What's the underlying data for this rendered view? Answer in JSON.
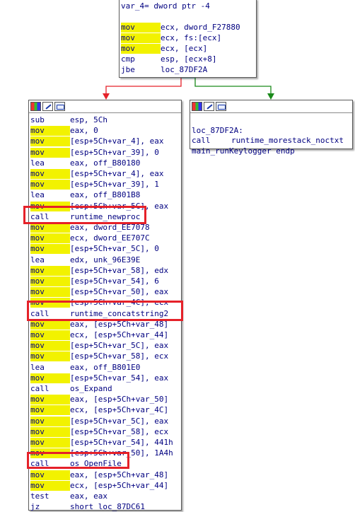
{
  "top_block": {
    "lines": [
      {
        "mnemonic": "var_4= dword ptr -4",
        "operands": "",
        "highlight": false
      },
      {
        "mnemonic": "",
        "operands": "",
        "highlight": false
      },
      {
        "mnemonic": "mov",
        "operands": "ecx, dword_F27880",
        "highlight": true
      },
      {
        "mnemonic": "mov",
        "operands": "ecx, fs:[ecx]",
        "highlight": true
      },
      {
        "mnemonic": "mov",
        "operands": "ecx, [ecx]",
        "highlight": true
      },
      {
        "mnemonic": "cmp",
        "operands": "esp, [ecx+8]",
        "highlight": false
      },
      {
        "mnemonic": "jbe",
        "operands": "loc_87DF2A",
        "highlight": false
      }
    ]
  },
  "left_block": {
    "lines": [
      {
        "mnemonic": "sub",
        "operands": "esp, 5Ch",
        "highlight": false
      },
      {
        "mnemonic": "mov",
        "operands": "eax, 0",
        "highlight": true
      },
      {
        "mnemonic": "mov",
        "operands": "[esp+5Ch+var_4], eax",
        "highlight": true
      },
      {
        "mnemonic": "mov",
        "operands": "[esp+5Ch+var_39], 0",
        "highlight": true
      },
      {
        "mnemonic": "lea",
        "operands": "eax, off_B80180",
        "highlight": false
      },
      {
        "mnemonic": "mov",
        "operands": "[esp+5Ch+var_4], eax",
        "highlight": true
      },
      {
        "mnemonic": "mov",
        "operands": "[esp+5Ch+var_39], 1",
        "highlight": true
      },
      {
        "mnemonic": "lea",
        "operands": "eax, off_B801B8",
        "highlight": false
      },
      {
        "mnemonic": "mov",
        "operands": "[esp+5Ch+var_5C], eax",
        "highlight": true
      },
      {
        "mnemonic": "call",
        "operands": "runtime_newproc",
        "highlight": false
      },
      {
        "mnemonic": "mov",
        "operands": "eax, dword_EE7078",
        "highlight": true
      },
      {
        "mnemonic": "mov",
        "operands": "ecx, dword_EE707C",
        "highlight": true
      },
      {
        "mnemonic": "mov",
        "operands": "[esp+5Ch+var_5C], 0",
        "highlight": true
      },
      {
        "mnemonic": "lea",
        "operands": "edx, unk_96E39E",
        "highlight": false
      },
      {
        "mnemonic": "mov",
        "operands": "[esp+5Ch+var_58], edx",
        "highlight": true
      },
      {
        "mnemonic": "mov",
        "operands": "[esp+5Ch+var_54], 6",
        "highlight": true
      },
      {
        "mnemonic": "mov",
        "operands": "[esp+5Ch+var_50], eax",
        "highlight": true
      },
      {
        "mnemonic": "mov",
        "operands": "[esp+5Ch+var_4C], ecx",
        "highlight": true
      },
      {
        "mnemonic": "call",
        "operands": "runtime_concatstring2",
        "highlight": false
      },
      {
        "mnemonic": "mov",
        "operands": "eax, [esp+5Ch+var_48]",
        "highlight": true
      },
      {
        "mnemonic": "mov",
        "operands": "ecx, [esp+5Ch+var_44]",
        "highlight": true
      },
      {
        "mnemonic": "mov",
        "operands": "[esp+5Ch+var_5C], eax",
        "highlight": true
      },
      {
        "mnemonic": "mov",
        "operands": "[esp+5Ch+var_58], ecx",
        "highlight": true
      },
      {
        "mnemonic": "lea",
        "operands": "eax, off_B801E0",
        "highlight": false
      },
      {
        "mnemonic": "mov",
        "operands": "[esp+5Ch+var_54], eax",
        "highlight": true
      },
      {
        "mnemonic": "call",
        "operands": "os_Expand",
        "highlight": false
      },
      {
        "mnemonic": "mov",
        "operands": "eax, [esp+5Ch+var_50]",
        "highlight": true
      },
      {
        "mnemonic": "mov",
        "operands": "ecx, [esp+5Ch+var_4C]",
        "highlight": true
      },
      {
        "mnemonic": "mov",
        "operands": "[esp+5Ch+var_5C], eax",
        "highlight": true
      },
      {
        "mnemonic": "mov",
        "operands": "[esp+5Ch+var_58], ecx",
        "highlight": true
      },
      {
        "mnemonic": "mov",
        "operands": "[esp+5Ch+var_54], 441h",
        "highlight": true
      },
      {
        "mnemonic": "mov",
        "operands": "[esp+5Ch+var_50], 1A4h",
        "highlight": true
      },
      {
        "mnemonic": "call",
        "operands": "os_OpenFile",
        "highlight": false
      },
      {
        "mnemonic": "mov",
        "operands": "eax, [esp+5Ch+var_48]",
        "highlight": true
      },
      {
        "mnemonic": "mov",
        "operands": "ecx, [esp+5Ch+var_44]",
        "highlight": true
      },
      {
        "mnemonic": "test",
        "operands": "eax, eax",
        "highlight": false
      },
      {
        "mnemonic": "jz",
        "operands": "short loc_87DC61",
        "highlight": false
      }
    ]
  },
  "right_block": {
    "lines": [
      {
        "mnemonic": "",
        "operands": "",
        "highlight": false
      },
      {
        "mnemonic": "loc_87DF2A:",
        "operands": "",
        "highlight": false
      },
      {
        "mnemonic": "call",
        "operands": "runtime_morestack_noctxt",
        "highlight": false
      },
      {
        "mnemonic": "main_runKeylogger endp",
        "operands": "",
        "highlight": false
      }
    ]
  },
  "header_icons": [
    "color-palette-icon",
    "rename-pencil-icon",
    "graph-overview-icon"
  ],
  "colors": {
    "highlight": "#f2f200",
    "text": "#000080",
    "edge_false": "#e52129",
    "edge_true": "#1a8a1a",
    "edge_neutral": "#3aa8a8",
    "annotation_box": "#e52129"
  }
}
